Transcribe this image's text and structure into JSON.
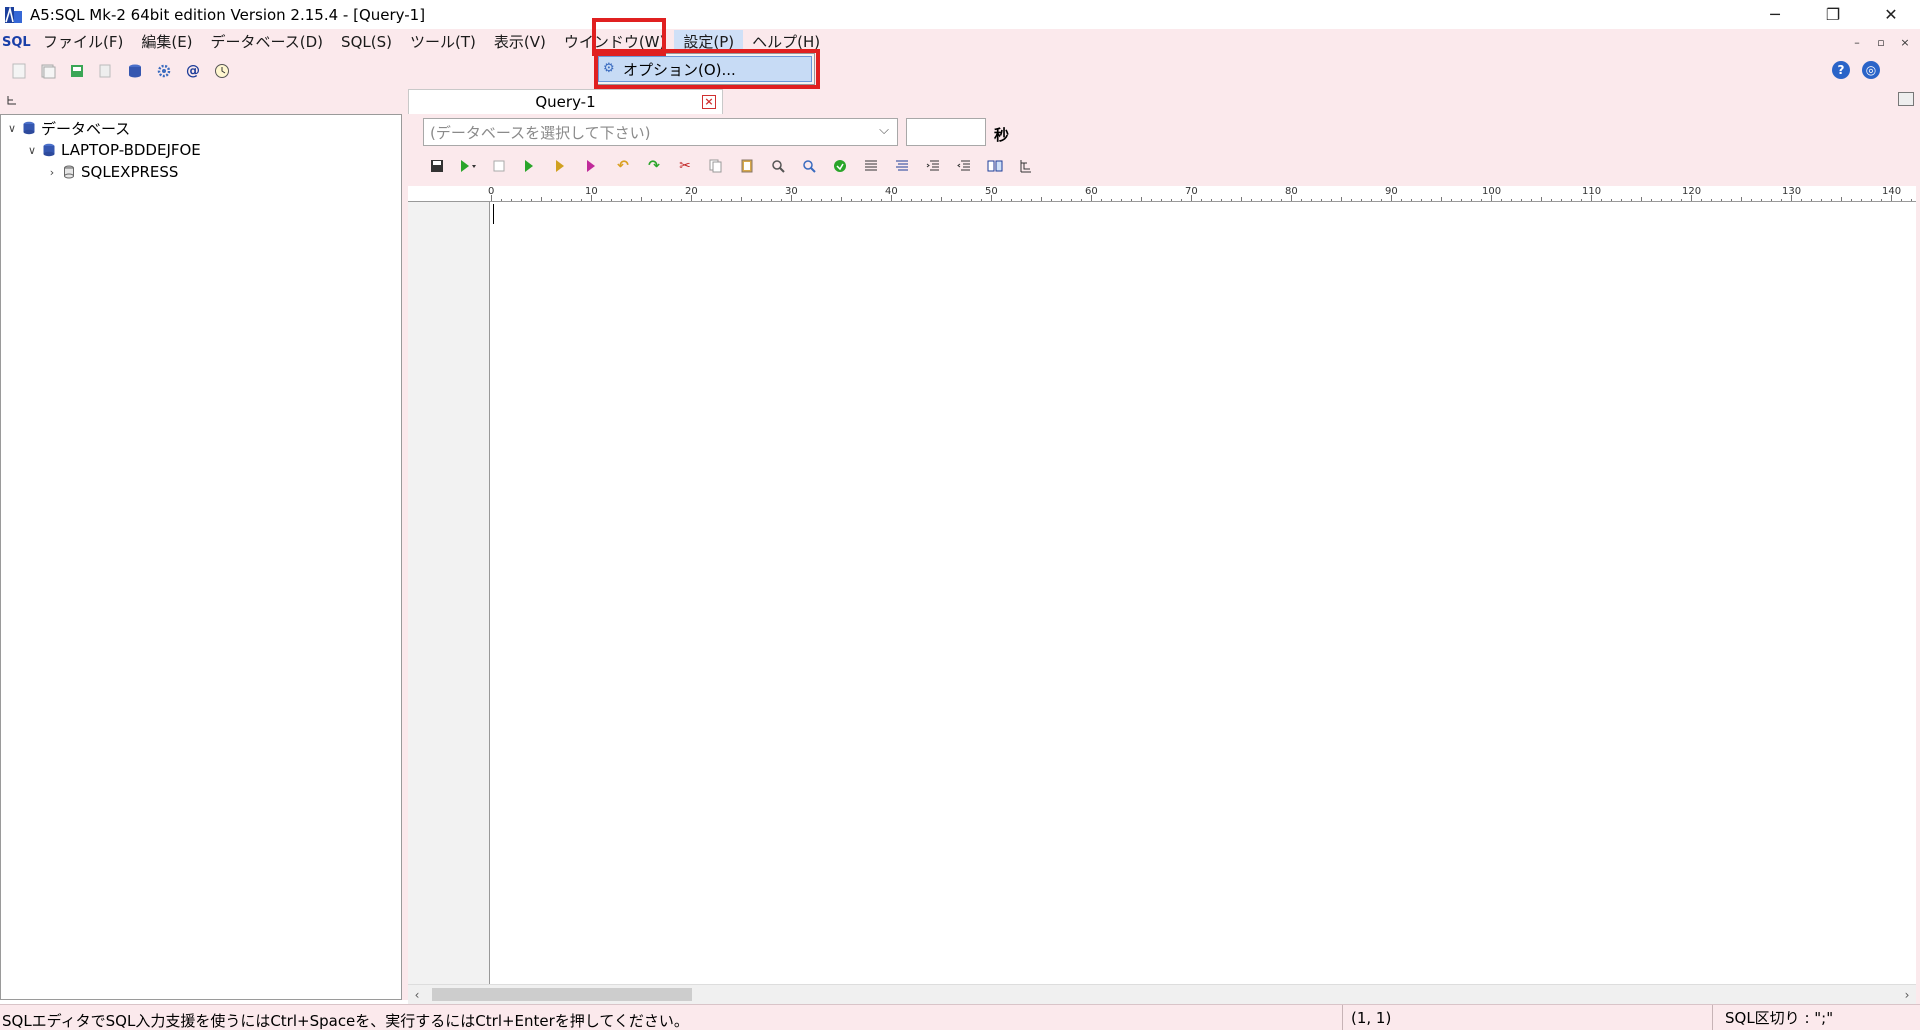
{
  "window": {
    "title": "A5:SQL Mk-2 64bit edition Version 2.15.4 - [Query-1]",
    "minimize": "─",
    "restore": "❐",
    "close": "✕"
  },
  "menu": {
    "sql_icon": "SQL",
    "items": [
      "ファイル(F)",
      "編集(E)",
      "データベース(D)",
      "SQL(S)",
      "ツール(T)",
      "表示(V)",
      "ウインドウ(W)",
      "設定(P)",
      "ヘルプ(H)"
    ],
    "active_index": 7,
    "mdi": {
      "minimize": "–",
      "restore": "▫",
      "close": "×"
    }
  },
  "dropdown": {
    "items": [
      {
        "label": "オプション(O)...",
        "icon": "gear-icon"
      }
    ]
  },
  "tree": {
    "root_label": "データベース",
    "host_label": "LAPTOP-BDDEJFOE",
    "instance_label": "SQLEXPRESS"
  },
  "editor_tab": {
    "label": "Query-1",
    "close": "×"
  },
  "query_panel": {
    "db_select_placeholder": "(データベースを選択して下さい)",
    "seconds_label": "秒"
  },
  "ruler": {
    "labels": [
      "0",
      "10",
      "20",
      "30",
      "40",
      "50",
      "60",
      "70",
      "80",
      "90",
      "100",
      "110",
      "120",
      "130",
      "140"
    ]
  },
  "statusbar": {
    "message": "SQLエディタでSQL入力支援を使うにはCtrl+Spaceを、実行するにはCtrl+Enterを押してください。",
    "position": "(1, 1)",
    "separator": "SQL区切り : \";\""
  },
  "colors": {
    "chrome_background": "#fbe9ec",
    "highlight_box": "#e02020",
    "menu_selection": "#c7dbf5"
  }
}
